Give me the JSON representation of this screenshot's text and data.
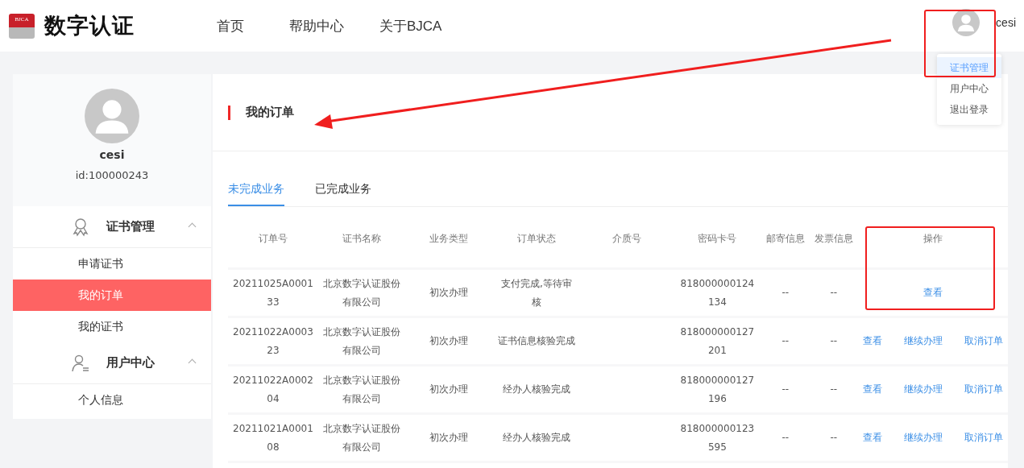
{
  "header": {
    "logo_badge": "BJCA",
    "logo_text": "数字认证",
    "nav": [
      {
        "label": "首页"
      },
      {
        "label": "帮助中心"
      },
      {
        "label": "关于BJCA"
      }
    ],
    "user": "cesi"
  },
  "user_menu": [
    {
      "label": "证书管理",
      "selected": true
    },
    {
      "label": "用户中心",
      "selected": false
    },
    {
      "label": "退出登录",
      "selected": false
    }
  ],
  "profile": {
    "name": "cesi",
    "id": "id:100000243"
  },
  "sidebar": [
    {
      "label": "证书管理",
      "kind": "certificate",
      "expanded": true,
      "children": [
        {
          "label": "申请证书",
          "selected": false
        },
        {
          "label": "我的订单",
          "selected": true
        },
        {
          "label": "我的证书",
          "selected": false
        }
      ]
    },
    {
      "label": "用户中心",
      "kind": "user",
      "expanded": true,
      "children": [
        {
          "label": "个人信息",
          "selected": false
        }
      ]
    }
  ],
  "page_title": "我的订单",
  "tabs": [
    {
      "label": "未完成业务",
      "selected": true
    },
    {
      "label": "已完成业务",
      "selected": false
    }
  ],
  "table": {
    "columns": [
      "订单号",
      "证书名称",
      "业务类型",
      "订单状态",
      "介质号",
      "密码卡号",
      "邮寄信息",
      "发票信息",
      "操作"
    ],
    "rows": [
      {
        "cells": [
          "20211025A000133",
          "北京数字认证股份有限公司",
          "初次办理",
          "支付完成,等待审核",
          "",
          "818000000124134",
          "--",
          "--"
        ],
        "actions": [
          "查看"
        ]
      },
      {
        "cells": [
          "20211022A000323",
          "北京数字认证股份有限公司",
          "初次办理",
          "证书信息核验完成",
          "",
          "818000000127201",
          "--",
          "--"
        ],
        "actions": [
          "查看",
          "继续办理",
          "取消订单"
        ]
      },
      {
        "cells": [
          "20211022A000204",
          "北京数字认证股份有限公司",
          "初次办理",
          "经办人核验完成",
          "",
          "818000000127196",
          "--",
          "--"
        ],
        "actions": [
          "查看",
          "继续办理",
          "取消订单"
        ]
      },
      {
        "cells": [
          "20211021A000108",
          "北京数字认证股份有限公司",
          "初次办理",
          "经办人核验完成",
          "",
          "818000000123595",
          "--",
          "--"
        ],
        "actions": [
          "查看",
          "继续办理",
          "取消订单"
        ]
      }
    ]
  },
  "annotations": [
    {
      "kind": "box"
    },
    {
      "kind": "box"
    },
    {
      "kind": "arrow"
    }
  ]
}
